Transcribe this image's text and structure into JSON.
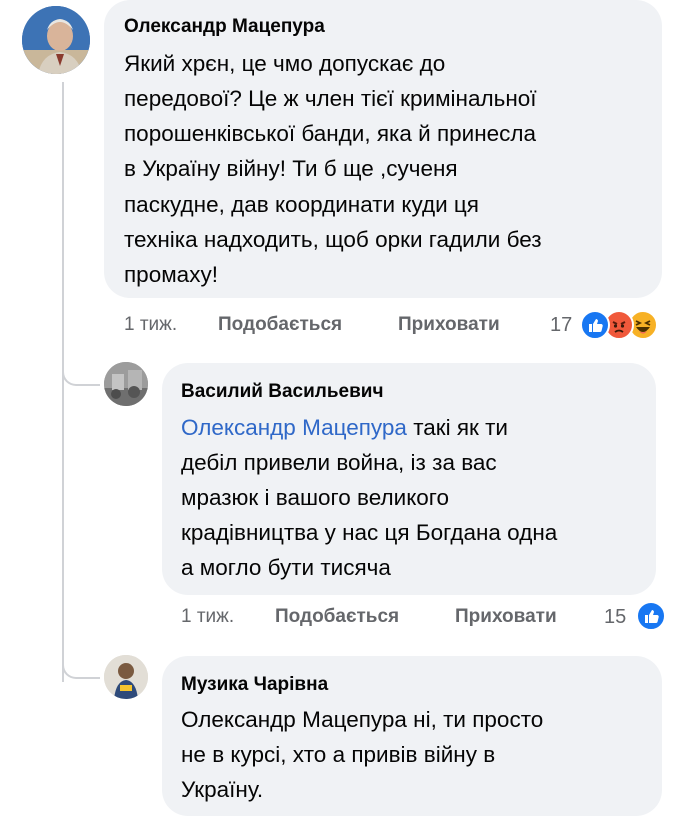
{
  "comments": [
    {
      "author": "Олександр Мацепура",
      "text": [
        "Який хрєн, це чмо допускає до",
        "передової? Це ж член тієї кримінальної",
        "порошенківської банди, яка й принесла",
        "в Україну війну! Ти б ще ,сученя",
        "паскудне, дав координати куди ця",
        "техніка надходить, щоб орки  гадили без",
        "промаху!"
      ],
      "time": "1 тиж.",
      "like_label": "Подобається",
      "hide_label": "Приховати",
      "reaction_count": "17",
      "reactions": [
        "like-icon",
        "angry-icon",
        "haha-icon"
      ]
    },
    {
      "author": "Василий Васильевич",
      "mention": "Олександр Мацепура",
      "text_first": " такі як ти",
      "text": [
        "дебіл привели война, із за вас",
        "мразюк і вашого великого",
        "крадівництва у нас ця Богдана одна",
        "а могло бути тисяча"
      ],
      "time": "1 тиж.",
      "like_label": "Подобається",
      "hide_label": "Приховати",
      "reaction_count": "15",
      "reactions": [
        "like-icon"
      ]
    },
    {
      "author": "Музика Чарівна",
      "text": [
        "Олександр Мацепура ні, ти просто",
        "не в курсі, хто а привів війну в",
        "Україну."
      ]
    }
  ],
  "colors": {
    "bubble": "#f0f2f5",
    "mention": "#2f68c8",
    "meta": "#65676b",
    "like": "#1877f2",
    "angry": "#f0593b",
    "haha": "#f7b125"
  }
}
